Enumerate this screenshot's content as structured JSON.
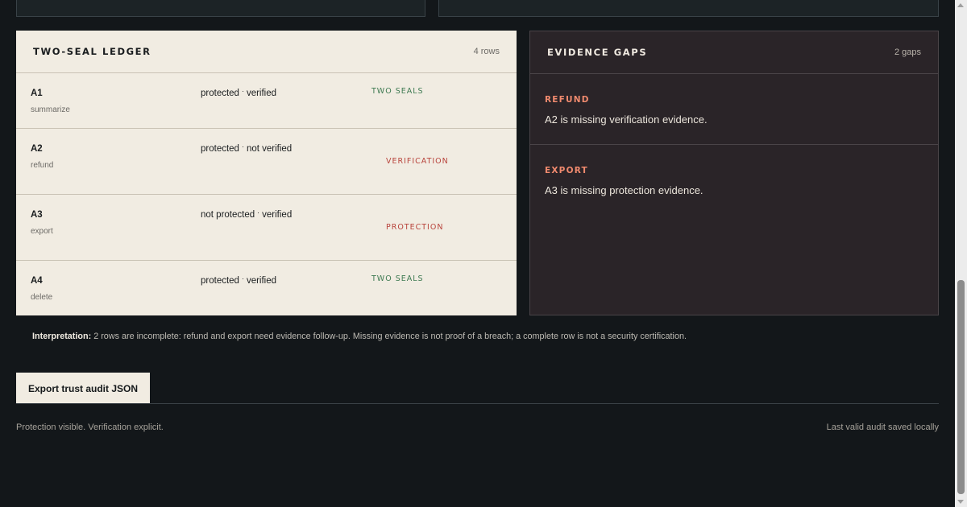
{
  "ledger": {
    "title": "TWO-SEAL LEDGER",
    "count": "4 rows",
    "rows": [
      {
        "id": "A1",
        "action": "summarize",
        "protection": "protected",
        "verification": "verified",
        "seal": "TWO SEALS",
        "seal_color": "#3e7a52"
      },
      {
        "id": "A2",
        "action": "refund",
        "protection": "protected",
        "verification": "not verified",
        "seal": "VERIFICATION",
        "seal_color": "#b8443c"
      },
      {
        "id": "A3",
        "action": "export",
        "protection": "not protected",
        "verification": "verified",
        "seal": "PROTECTION",
        "seal_color": "#b8443c"
      },
      {
        "id": "A4",
        "action": "delete",
        "protection": "protected",
        "verification": "verified",
        "seal": "TWO SEALS",
        "seal_color": "#3e7a52"
      }
    ],
    "separator": "·"
  },
  "gaps": {
    "title": "EVIDENCE GAPS",
    "count": "2 gaps",
    "items": [
      {
        "name": "REFUND",
        "text": "A2 is missing verification evidence."
      },
      {
        "name": "EXPORT",
        "text": "A3 is missing protection evidence."
      }
    ]
  },
  "interpretation": {
    "label": "Interpretation:",
    "text": "2 rows are incomplete: refund and export need evidence follow-up. Missing evidence is not proof of a breach; a complete row is not a security certification."
  },
  "export_button": "Export trust audit JSON",
  "footer": {
    "left": "Protection visible. Verification explicit.",
    "right": "Last valid audit saved locally"
  },
  "colors": {
    "page_bg": "#13171a",
    "ledger_bg": "#f1ece2",
    "gaps_bg": "#2a2428",
    "ok": "#3e7a52",
    "gap": "#b8443c",
    "gap_heading": "#f08a6e"
  }
}
